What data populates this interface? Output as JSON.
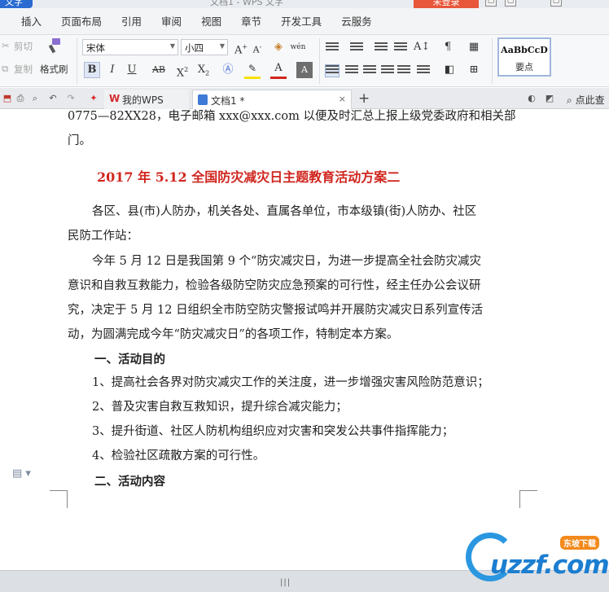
{
  "titlebar": {
    "app_menu": "文字",
    "doc_title": "文档1 - WPS 文字",
    "login": "未登录",
    "controls": [
      "▢",
      "▢",
      "▢"
    ]
  },
  "ribbon_tabs": [
    "插入",
    "页面布局",
    "引用",
    "审阅",
    "视图",
    "章节",
    "开发工具",
    "云服务"
  ],
  "ribbon": {
    "cut": "剪切",
    "copy": "复制",
    "format_painter": "格式刷",
    "font_name": "宋体",
    "font_size": "小四",
    "bold": "B",
    "italic": "I",
    "underline": "U",
    "strike": "AB",
    "superscript": "X",
    "subscript": "X",
    "font_color_letter": "A",
    "highlight_letter": "A",
    "style_sample": "AaBbCcD",
    "style_name": "要点",
    "accent_color": "#2b6bd1",
    "font_color": "#d0261e",
    "highlight_color": "#f6e200"
  },
  "doc_tabs": {
    "wps_tab": "我的WPS",
    "doc_tab": "文档1 *",
    "new_tab": "+",
    "search_help": "点此查"
  },
  "document": {
    "line1": "0775—82XX28，电子邮箱 xxx@xxx.com 以便及时汇总上报上级党委政府和相关部",
    "line2": "门。",
    "heading": "2017 年 5.12 全国防灾减灾日主题教育活动方案二",
    "p1_l1": "各区、县(市)人防办，机关各处、直属各单位，市本级镇(街)人防办、社区",
    "p1_l2": "民防工作站：",
    "p2_l1": "今年 5 月 12 日是我国第 9 个“防灾减灾日，为进一步提高全社会防灾减灾",
    "p2_l2": "意识和自救互救能力，检验各级防空防灾应急预案的可行性，经主任办公会议研",
    "p2_l3": "究，决定于 5 月 12 日组织全市防空防灾警报试鸣并开展防灾减灾日系列宣传活",
    "p2_l4": "动，为圆满完成今年“防灾减灾日”的各项工作，特制定本方案。",
    "sec1": "一、活动目的",
    "item1": "1、提高社会各界对防灾减灾工作的关注度，进一步增强灾害风险防范意识；",
    "item2": "2、普及灾害自救互救知识，提升综合减灾能力；",
    "item3": "3、提升街道、社区人防机构组织应对灾害和突发公共事件指挥能力；",
    "item4": "4、检验社区疏散方案的可行性。",
    "sec2": "二、活动内容"
  },
  "watermark": {
    "brand": "uzzf.com",
    "tag": "东坡下载"
  }
}
